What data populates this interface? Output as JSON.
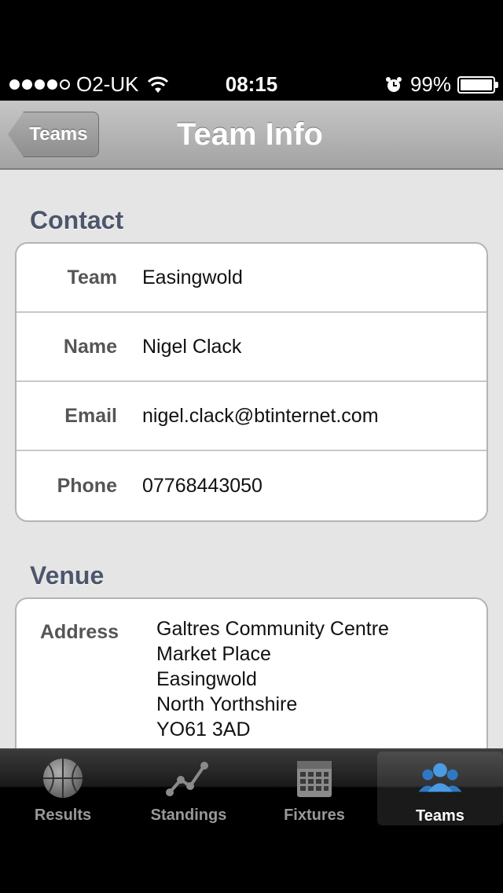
{
  "status_bar": {
    "carrier": "O2-UK",
    "time": "08:15",
    "battery_percent": "99%",
    "signal_bars_filled": 4,
    "signal_bars_total": 5,
    "battery_level": 0.99
  },
  "nav": {
    "back_label": "Teams",
    "title": "Team Info"
  },
  "contact": {
    "header": "Contact",
    "rows": [
      {
        "label": "Team",
        "value": "Easingwold"
      },
      {
        "label": "Name",
        "value": "Nigel Clack"
      },
      {
        "label": "Email",
        "value": "nigel.clack@btinternet.com"
      },
      {
        "label": "Phone",
        "value": "07768443050"
      }
    ]
  },
  "venue": {
    "header": "Venue",
    "address_label": "Address",
    "address_lines": [
      "Galtres Community Centre",
      "Market Place",
      "Easingwold",
      "North Yorthshire",
      "YO61 3AD"
    ]
  },
  "tabs": [
    {
      "label": "Results",
      "icon": "basketball-icon",
      "active": false
    },
    {
      "label": "Standings",
      "icon": "line-graph-icon",
      "active": false
    },
    {
      "label": "Fixtures",
      "icon": "calendar-icon",
      "active": false
    },
    {
      "label": "Teams",
      "icon": "people-icon",
      "active": true
    }
  ],
  "colors": {
    "section_header": "#4c566c",
    "active_tab_icon": "#3e8ed8",
    "inactive_tab_icon": "#8a8a8a"
  }
}
